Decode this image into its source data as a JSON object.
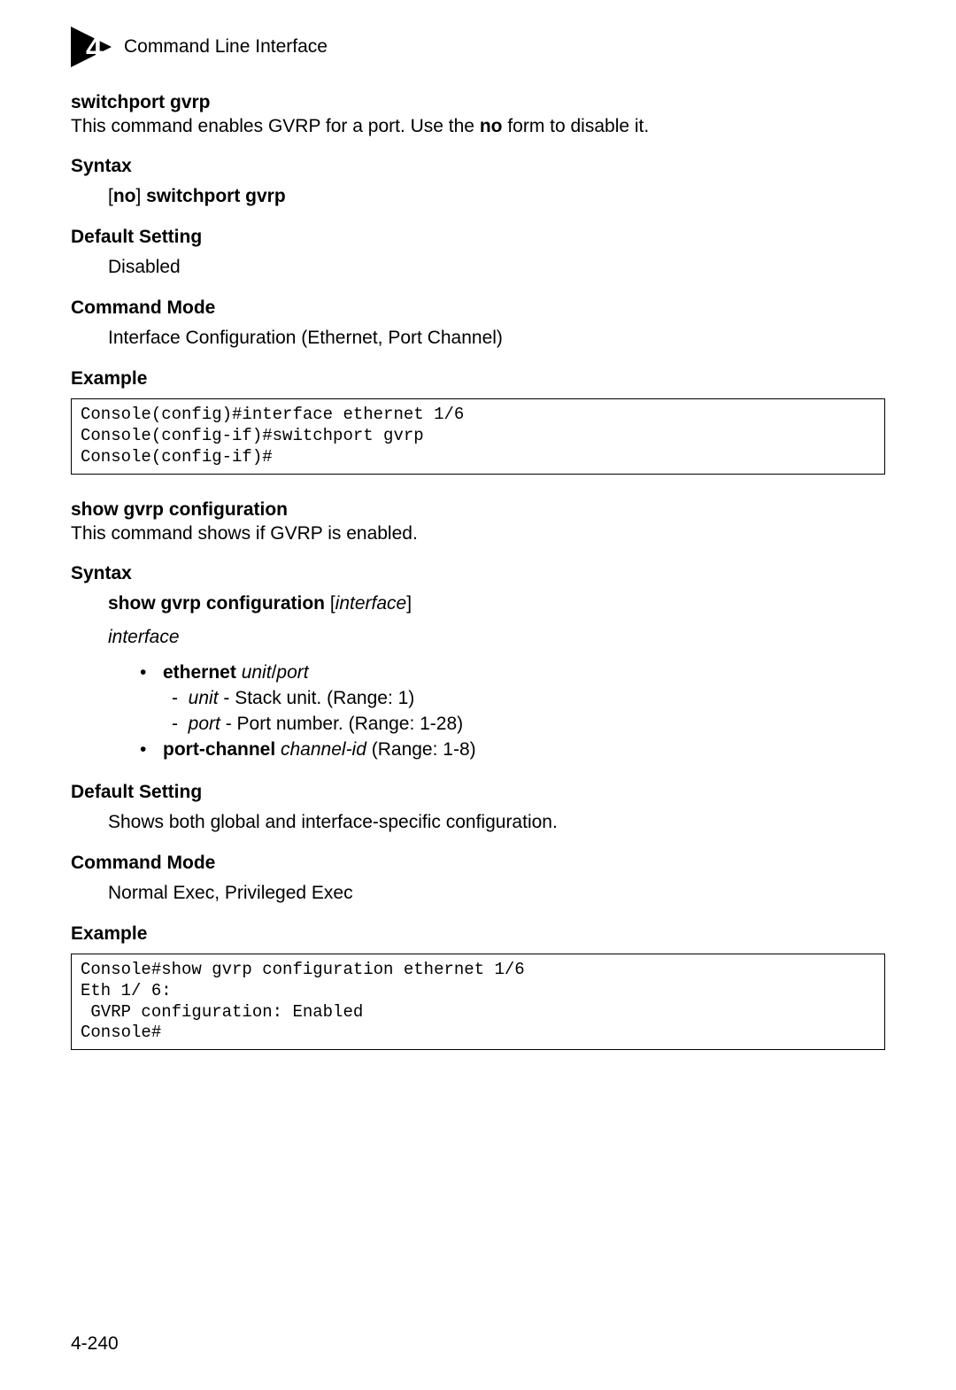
{
  "header": {
    "chapter_label": "4",
    "title": "Command Line Interface"
  },
  "cmd1": {
    "title": "switchport gvrp",
    "desc_a": "This command enables GVRP for a port. Use the ",
    "desc_no": "no",
    "desc_b": " form to disable it.",
    "syntax_label": "Syntax",
    "syntax_no_open": "[",
    "syntax_no": "no",
    "syntax_no_close": "] ",
    "syntax_cmd": "switchport gvrp",
    "default_label": "Default Setting",
    "default_value": "Disabled",
    "mode_label": "Command Mode",
    "mode_value": "Interface Configuration (Ethernet, Port Channel)",
    "example_label": "Example",
    "example_code": "Console(config)#interface ethernet 1/6\nConsole(config-if)#switchport gvrp\nConsole(config-if)#"
  },
  "cmd2": {
    "title": "show gvrp configuration",
    "desc": "This command shows if GVRP is enabled.",
    "syntax_label": "Syntax",
    "syn_cmd_bold": "show gvrp configuration",
    "syn_cmd_open": " [",
    "syn_cmd_param": "interface",
    "syn_cmd_close": "]",
    "interface_word": "interface",
    "ethernet_bold": "ethernet",
    "ethernet_unit": " unit",
    "ethernet_sep": "/",
    "ethernet_port": "port",
    "unit_i": "unit",
    "unit_t": " - Stack unit. (Range: 1)",
    "port_i": "port",
    "port_t": " - Port number. (Range: 1-28)",
    "pc_bold": "port-channel",
    "pc_i": " channel-id",
    "pc_t": " (Range: 1-8)",
    "default_label": "Default Setting",
    "default_value": "Shows both global and interface-specific configuration.",
    "mode_label": "Command Mode",
    "mode_value": "Normal Exec, Privileged Exec",
    "example_label": "Example",
    "example_code": "Console#show gvrp configuration ethernet 1/6\nEth 1/ 6:\n GVRP configuration: Enabled\nConsole#"
  },
  "page_number": "4-240"
}
